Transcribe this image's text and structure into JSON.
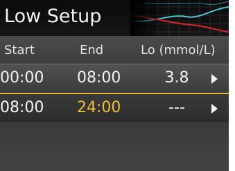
{
  "screen": {
    "title": "Low Setup"
  },
  "table": {
    "headers": {
      "start": "Start",
      "end": "End",
      "lo": "Lo (mmol/L)"
    },
    "rows": [
      {
        "start": "00:00",
        "end": "08:00",
        "lo": "3.8"
      },
      {
        "start": "08:00",
        "end": "24:00",
        "lo": "---"
      }
    ]
  },
  "colors": {
    "selected_border": "#e0b33a",
    "selected_value": "#f0c030",
    "graph_line_red": "#c8262c",
    "graph_line_cyan": "#4fc4d6"
  },
  "icons": {
    "row_arrow": "chevron-right-icon"
  }
}
